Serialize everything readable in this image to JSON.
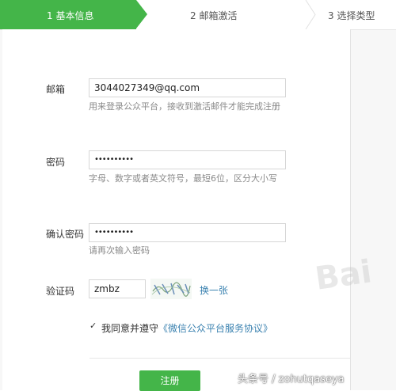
{
  "steps": {
    "step1": "1 基本信息",
    "step2": "2 邮箱激活",
    "step3": "3 选择类型"
  },
  "form": {
    "email": {
      "label": "邮箱",
      "value": "3044027349@qq.com",
      "hint": "用来登录公众平台，接收到激活邮件才能完成注册"
    },
    "password": {
      "label": "密码",
      "value": "••••••••••",
      "hint": "字母、数字或者英文符号，最短6位，区分大小写"
    },
    "confirm": {
      "label": "确认密码",
      "value": "••••••••••",
      "hint": "请再次输入密码"
    },
    "captcha": {
      "label": "验证码",
      "value": "zmbz",
      "refresh": "换一张"
    },
    "agree": {
      "checkmark": "✓",
      "prefix": "我同意并遵守",
      "protocol": "《微信公众平台服务协议》"
    },
    "submit": "注册"
  },
  "overlay": {
    "watermark": "Bai",
    "credit": "头条号 / zohutqaseya"
  },
  "colors": {
    "accent": "#44b549",
    "link": "#3b82b0"
  }
}
